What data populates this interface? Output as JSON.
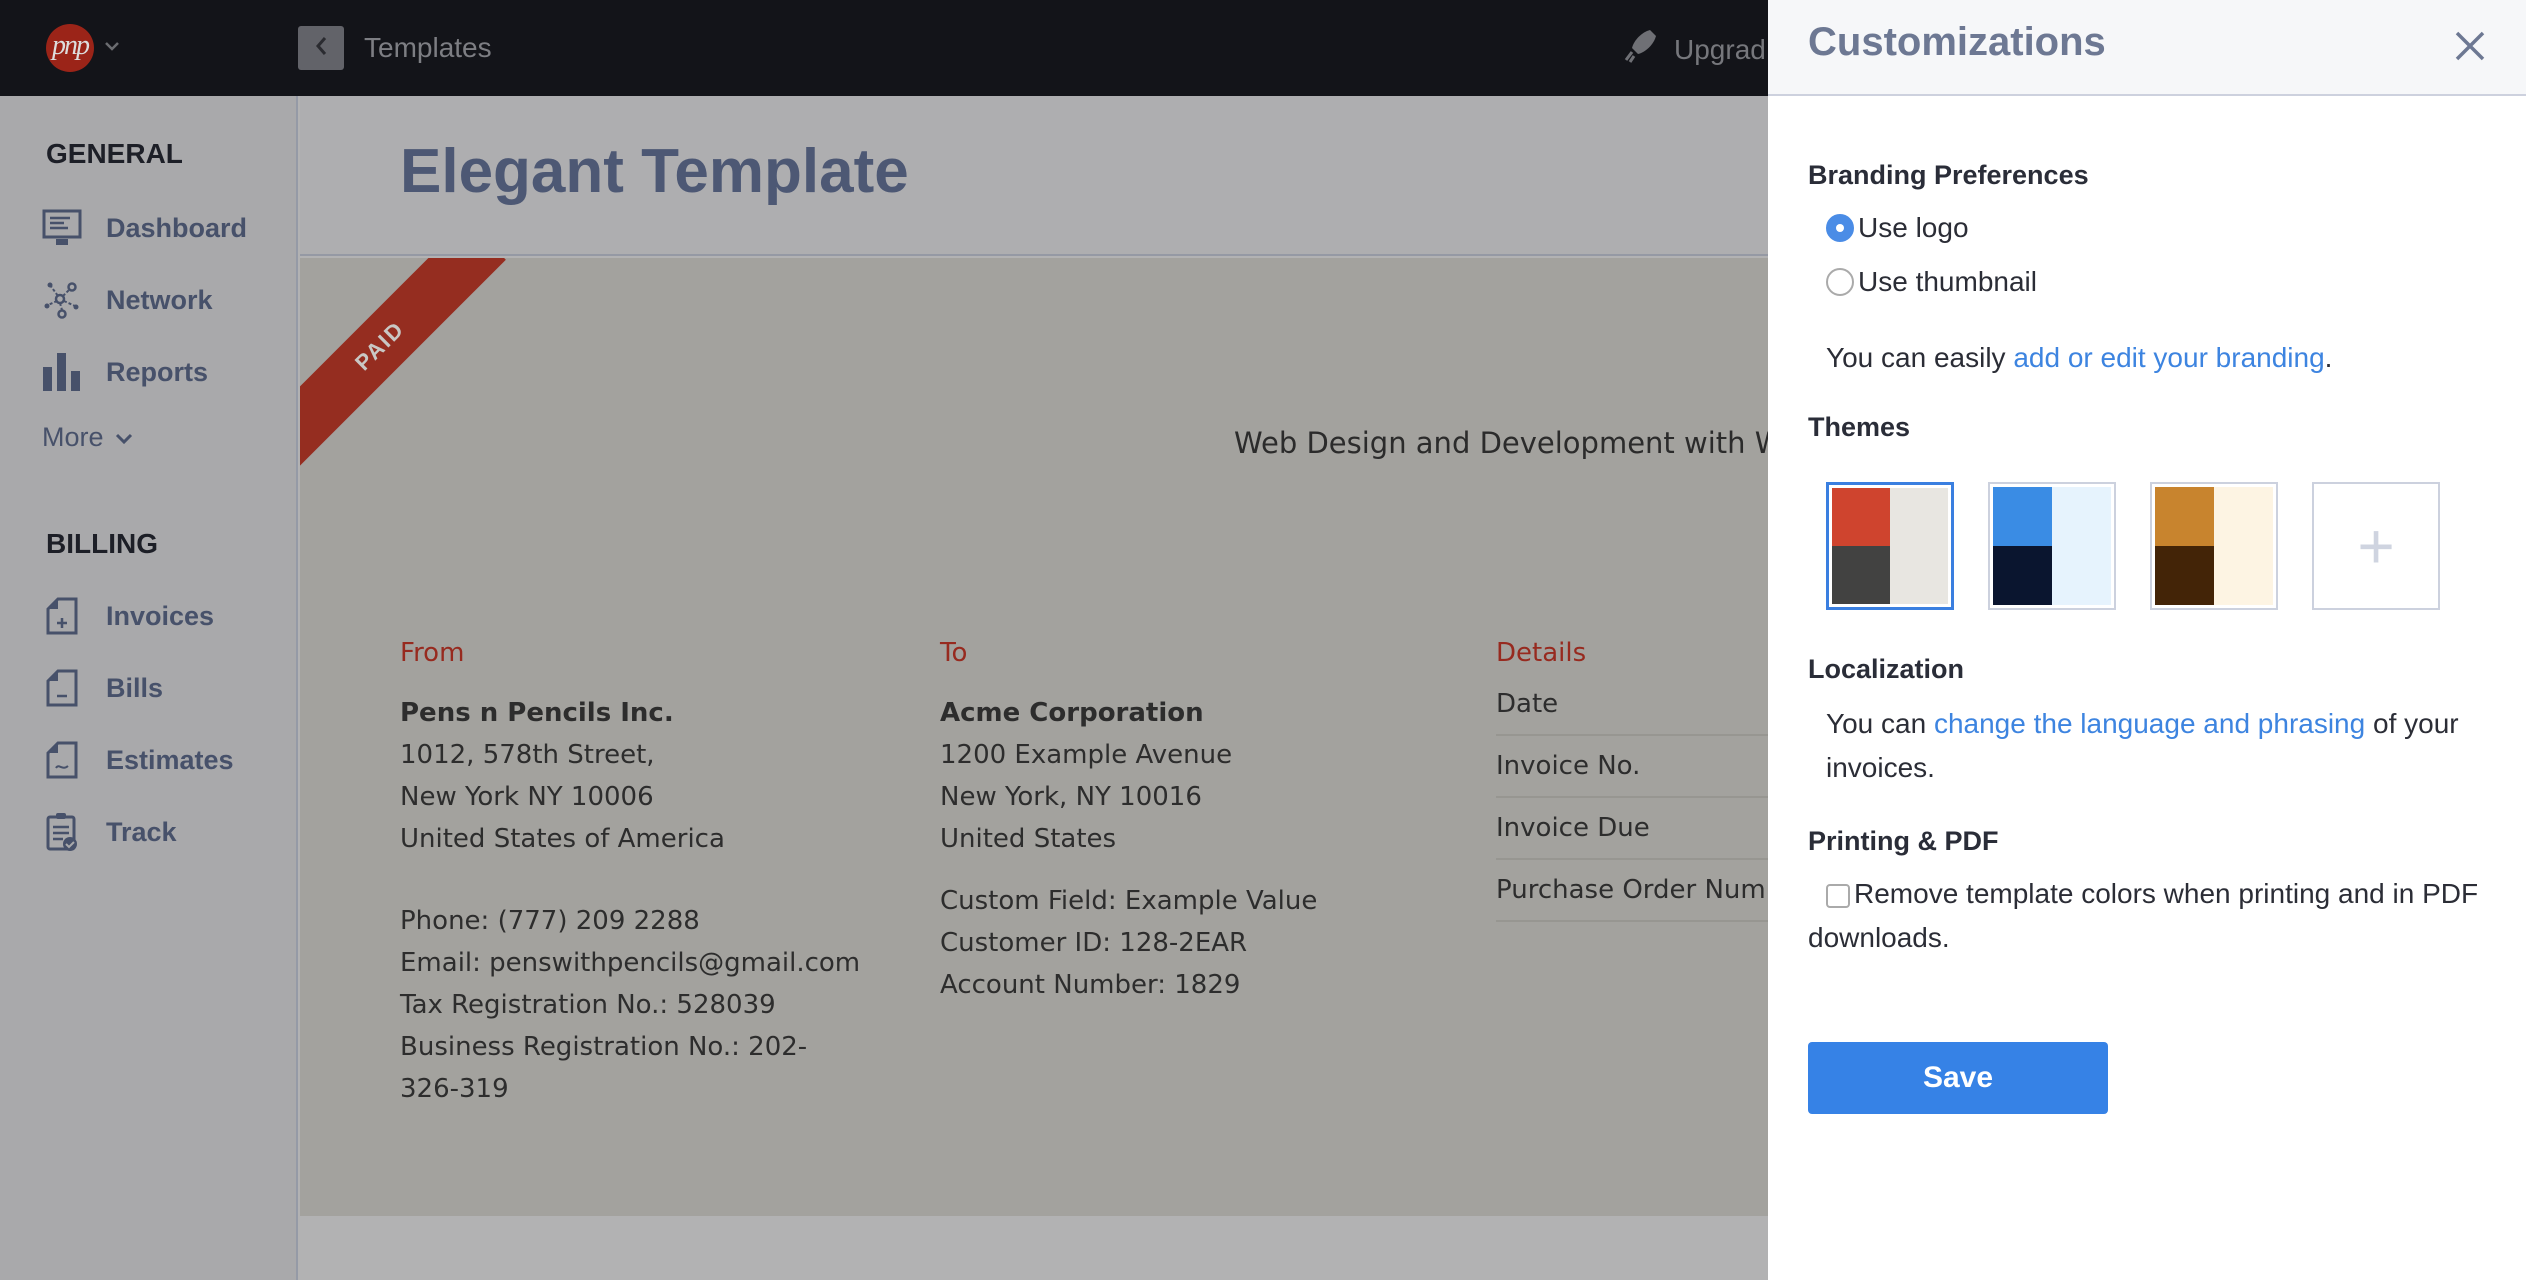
{
  "topbar": {
    "logo_text": "pnp",
    "breadcrumb": "Templates",
    "upgrade_label": "Upgrad"
  },
  "sidebar": {
    "general_heading": "GENERAL",
    "general_items": [
      {
        "label": "Dashboard",
        "icon": "monitor-icon"
      },
      {
        "label": "Network",
        "icon": "network-icon"
      },
      {
        "label": "Reports",
        "icon": "bar-chart-icon"
      }
    ],
    "more_label": "More",
    "billing_heading": "BILLING",
    "billing_items": [
      {
        "label": "Invoices",
        "icon": "invoice-plus-icon"
      },
      {
        "label": "Bills",
        "icon": "bill-minus-icon"
      },
      {
        "label": "Estimates",
        "icon": "estimate-tilde-icon"
      },
      {
        "label": "Track",
        "icon": "clipboard-check-icon"
      }
    ]
  },
  "main": {
    "page_title": "Elegant Template",
    "invoice": {
      "status_ribbon": "PAID",
      "project_title": "Web Design and Development with Word",
      "from": {
        "label": "From",
        "company": "Pens n Pencils Inc.",
        "address": [
          "1012, 578th Street,",
          "New York NY 10006",
          "United States of America"
        ],
        "extra": [
          "Phone: (777) 209 2288",
          "Email: penswithpencils@gmail.com",
          "Tax Registration No.: 528039",
          "Business Registration No.: 202-326-319"
        ]
      },
      "to": {
        "label": "To",
        "company": "Acme Corporation",
        "address": [
          "1200 Example Avenue",
          "New York, NY 10016",
          "United States"
        ],
        "extra": [
          "Custom Field: Example Value",
          "Customer ID: 128-2EAR",
          "Account Number: 1829"
        ]
      },
      "details": {
        "label": "Details",
        "rows": [
          "Date",
          "Invoice No.",
          "Invoice Due",
          "Purchase Order Number"
        ]
      }
    }
  },
  "panel": {
    "title": "Customizations",
    "branding": {
      "heading": "Branding Preferences",
      "options": [
        {
          "label": "Use logo",
          "selected": true
        },
        {
          "label": "Use thumbnail",
          "selected": false
        }
      ],
      "text_before": "You can easily ",
      "link": "add or edit your branding",
      "text_after": "."
    },
    "themes": {
      "heading": "Themes",
      "selected_index": 0,
      "items": [
        {
          "accent": "#cf442e",
          "dark": "#424241",
          "light": "#e8e6e1"
        },
        {
          "accent": "#3a8ce4",
          "dark": "#0a152f",
          "light": "#e6f3fd"
        },
        {
          "accent": "#c8842e",
          "dark": "#432407",
          "light": "#fdf4e3"
        }
      ],
      "add_label": "+"
    },
    "localization": {
      "heading": "Localization",
      "text_before": "You can ",
      "link": "change the language and phrasing",
      "text_after": " of your invoices."
    },
    "printing": {
      "heading": "Printing & PDF",
      "checkbox_label": "Remove template colors when printing and in PDF downloads.",
      "checked": false
    },
    "save_label": "Save"
  }
}
